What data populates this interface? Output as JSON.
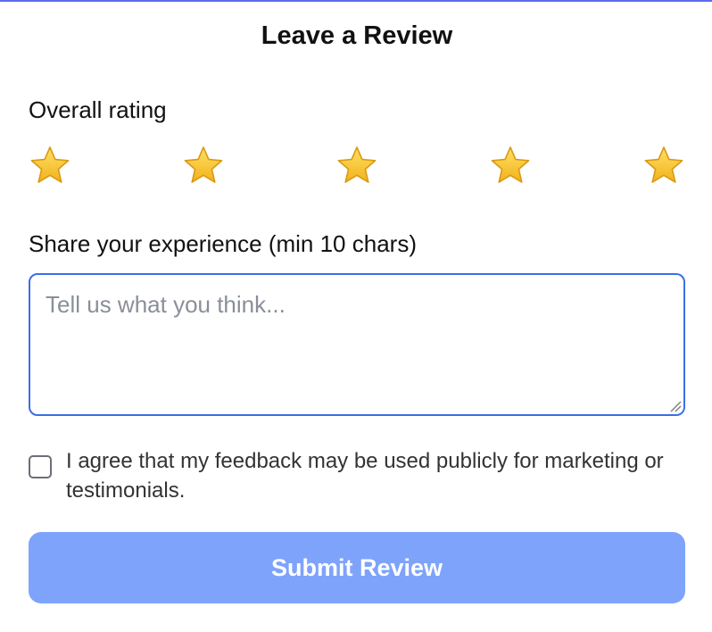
{
  "form": {
    "title": "Leave a Review",
    "rating": {
      "label": "Overall rating",
      "max_stars": 5,
      "selected": 0,
      "star_icon": "star-icon",
      "star_color": "#f7c948"
    },
    "experience": {
      "label": "Share your experience (min 10 chars)",
      "placeholder": "Tell us what you think...",
      "value": ""
    },
    "consent": {
      "label": "I agree that my feedback may be used publicly for marketing or testimonials.",
      "checked": false
    },
    "submit": {
      "label": "Submit Review",
      "color": "#7ea3fb"
    }
  },
  "colors": {
    "accent": "#3b6ee8",
    "top_border": "#5b6cf0"
  }
}
